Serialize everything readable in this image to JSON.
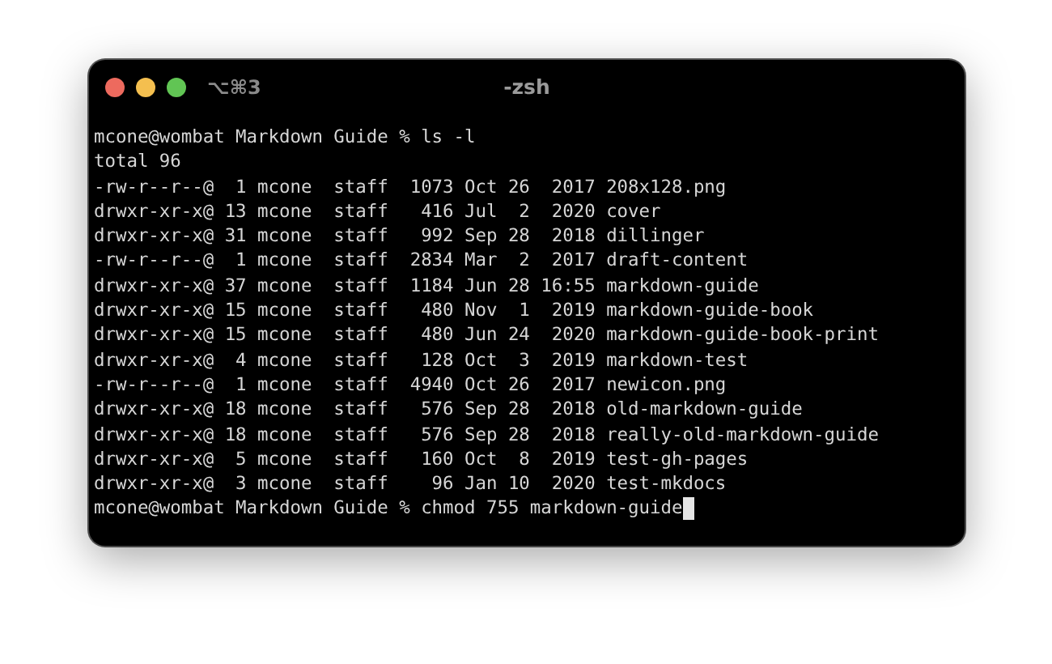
{
  "window": {
    "tab_shortcut": "⌥⌘3",
    "title": "-zsh"
  },
  "terminal": {
    "lines": [
      "mcone@wombat Markdown Guide % ls -l",
      "total 96",
      "-rw-r--r--@  1 mcone  staff  1073 Oct 26  2017 208x128.png",
      "drwxr-xr-x@ 13 mcone  staff   416 Jul  2  2020 cover",
      "drwxr-xr-x@ 31 mcone  staff   992 Sep 28  2018 dillinger",
      "-rw-r--r--@  1 mcone  staff  2834 Mar  2  2017 draft-content",
      "drwxr-xr-x@ 37 mcone  staff  1184 Jun 28 16:55 markdown-guide",
      "drwxr-xr-x@ 15 mcone  staff   480 Nov  1  2019 markdown-guide-book",
      "drwxr-xr-x@ 15 mcone  staff   480 Jun 24  2020 markdown-guide-book-print",
      "drwxr-xr-x@  4 mcone  staff   128 Oct  3  2019 markdown-test",
      "-rw-r--r--@  1 mcone  staff  4940 Oct 26  2017 newicon.png",
      "drwxr-xr-x@ 18 mcone  staff   576 Sep 28  2018 old-markdown-guide",
      "drwxr-xr-x@ 18 mcone  staff   576 Sep 28  2018 really-old-markdown-guide",
      "drwxr-xr-x@  5 mcone  staff   160 Oct  8  2019 test-gh-pages",
      "drwxr-xr-x@  3 mcone  staff    96 Jan 10  2020 test-mkdocs"
    ],
    "input": "mcone@wombat Markdown Guide % chmod 755 markdown-guide"
  }
}
